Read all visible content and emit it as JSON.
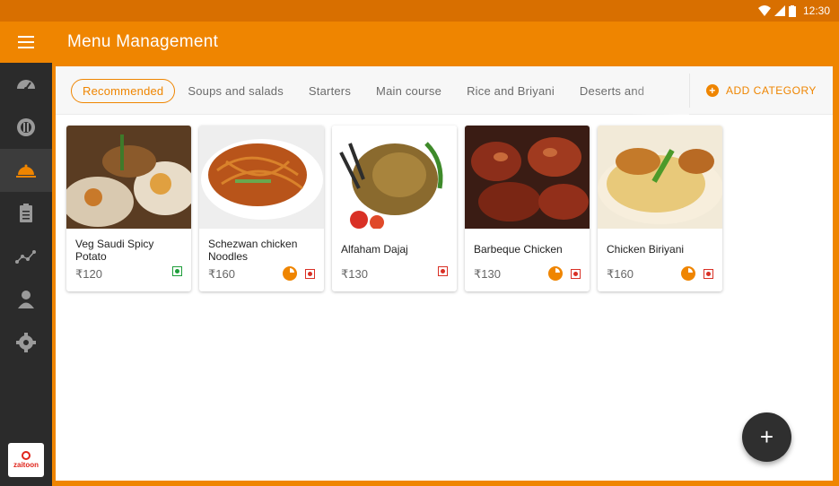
{
  "status_bar": {
    "time": "12:30",
    "icons": [
      "wifi-icon",
      "signal-icon",
      "battery-icon"
    ]
  },
  "app_bar": {
    "title": "Menu Management",
    "menu_icon": "hamburger-icon"
  },
  "sidebar": {
    "items": [
      {
        "icon": "dashboard-icon",
        "active": false
      },
      {
        "icon": "restaurant-icon",
        "active": false
      },
      {
        "icon": "cloche-icon",
        "active": true
      },
      {
        "icon": "clipboard-icon",
        "active": false
      },
      {
        "icon": "analytics-icon",
        "active": false
      },
      {
        "icon": "person-icon",
        "active": false
      },
      {
        "icon": "settings-icon",
        "active": false
      }
    ],
    "logo_text": "zaitoon"
  },
  "categories": {
    "tabs": [
      "Recommended",
      "Soups and salads",
      "Starters",
      "Main course",
      "Rice and Briyani",
      "Deserts and"
    ],
    "selected": "Recommended",
    "add_label": "ADD CATEGORY"
  },
  "colors": {
    "accent": "#ef8500",
    "sidebar": "#2b2b2b",
    "veg": "#1e9e3a",
    "nonveg": "#d93025"
  },
  "items": [
    {
      "name": "Veg Saudi Spicy Potato",
      "price": "₹120",
      "veg": true,
      "recommended_badge": false
    },
    {
      "name": "Schezwan chicken Noodles",
      "price": "₹160",
      "veg": false,
      "recommended_badge": true
    },
    {
      "name": "Alfaham Dajaj",
      "price": "₹130",
      "veg": false,
      "recommended_badge": false
    },
    {
      "name": "Barbeque Chicken",
      "price": "₹130",
      "veg": false,
      "recommended_badge": true
    },
    {
      "name": "Chicken Biriyani",
      "price": "₹160",
      "veg": false,
      "recommended_badge": true
    }
  ],
  "fab": {
    "label": "+"
  }
}
